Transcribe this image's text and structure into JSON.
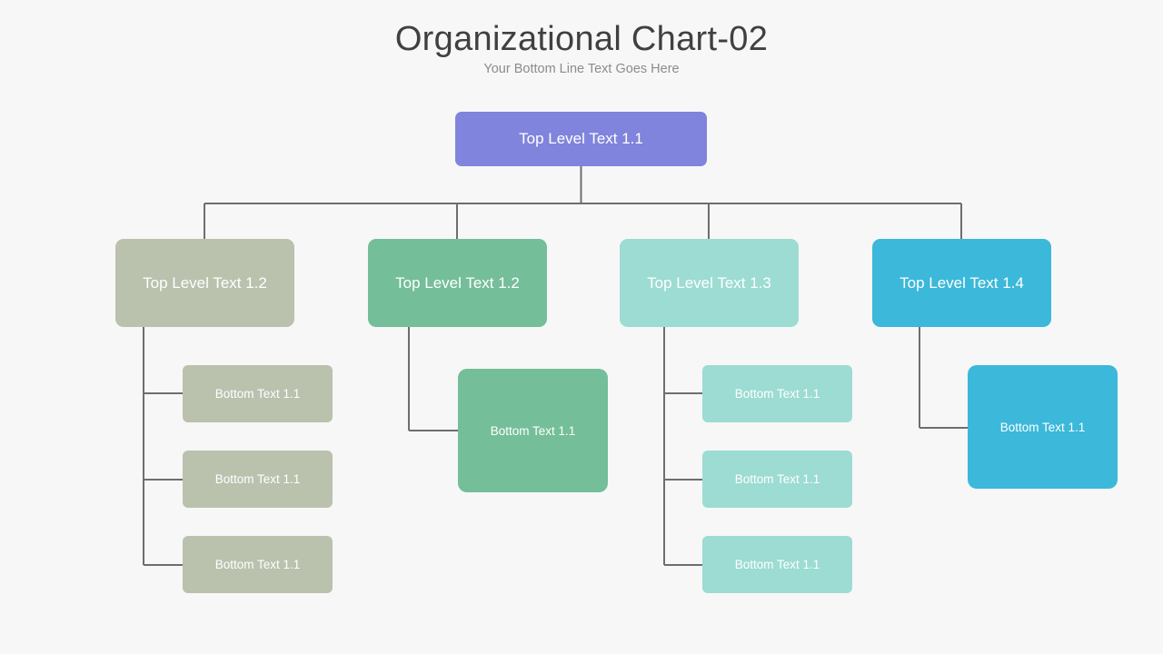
{
  "header": {
    "title": "Organizational Chart-02",
    "subtitle": "Your Bottom Line Text Goes Here"
  },
  "colors": {
    "background": "#f7f7f7",
    "connector": "#6e6e6e",
    "title_text": "#404040",
    "subtitle_text": "#8c8c8c",
    "node_text": "#ffffff",
    "root": "#8084dc",
    "branch1": "#bac2ae",
    "branch2": "#74be99",
    "branch3": "#9cdcd2",
    "branch4": "#3bb8da"
  },
  "chart_data": {
    "type": "diagram",
    "title": "Organizational Chart-02",
    "subtitle": "Your Bottom Line Text Goes Here",
    "orientation": "top-down-with-left-elbow-leaves",
    "root": {
      "id": "root",
      "label": "Top Level Text 1.1",
      "color": "#8084dc"
    },
    "branches": [
      {
        "id": "branch-1",
        "label": "Top Level Text 1.2",
        "color": "#bac2ae",
        "leaf_size": "small",
        "children": [
          {
            "id": "branch-1-leaf-1",
            "label": "Bottom Text 1.1"
          },
          {
            "id": "branch-1-leaf-2",
            "label": "Bottom Text 1.1"
          },
          {
            "id": "branch-1-leaf-3",
            "label": "Bottom Text 1.1"
          }
        ]
      },
      {
        "id": "branch-2",
        "label": "Top Level Text 1.2",
        "color": "#74be99",
        "leaf_size": "large",
        "children": [
          {
            "id": "branch-2-leaf-1",
            "label": "Bottom Text 1.1"
          }
        ]
      },
      {
        "id": "branch-3",
        "label": "Top Level Text 1.3",
        "color": "#9cdcd2",
        "leaf_size": "small",
        "children": [
          {
            "id": "branch-3-leaf-1",
            "label": "Bottom Text 1.1"
          },
          {
            "id": "branch-3-leaf-2",
            "label": "Bottom Text 1.1"
          },
          {
            "id": "branch-3-leaf-3",
            "label": "Bottom Text 1.1"
          }
        ]
      },
      {
        "id": "branch-4",
        "label": "Top Level Text 1.4",
        "color": "#3bb8da",
        "leaf_size": "large",
        "children": [
          {
            "id": "branch-4-leaf-1",
            "label": "Bottom Text 1.1"
          }
        ]
      }
    ]
  }
}
